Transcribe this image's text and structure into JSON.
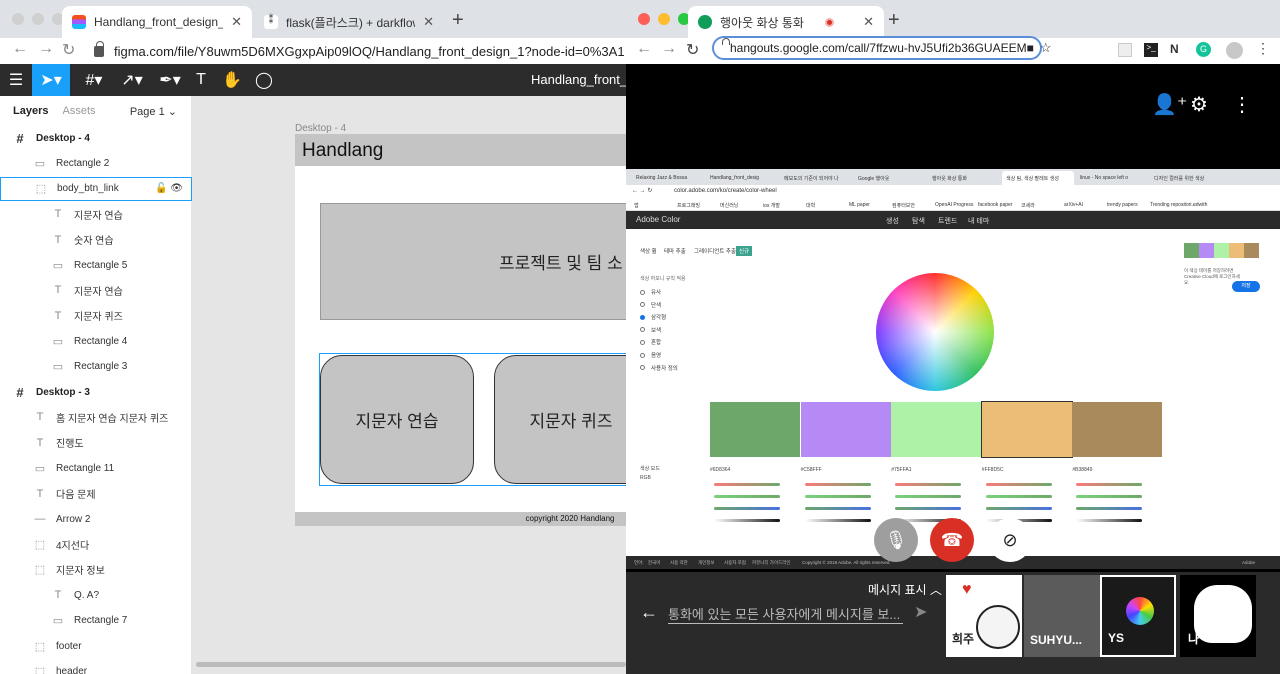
{
  "figma_window": {
    "tabs": [
      {
        "title": "Handlang_front_design_1 – Figma",
        "close": "✕"
      },
      {
        "title": "flask(플라스크) + darkflow YOLO로",
        "close": "✕"
      }
    ],
    "new_tab": "+",
    "url": "figma.com/file/Y8uwm5D6MXGgxpAip09lOQ/Handlang_front_design_1?node-id=0%3A1",
    "toolbar_title": "Handlang_front_de",
    "panel_tabs": {
      "layers": "Layers",
      "assets": "Assets",
      "page": "Page 1"
    },
    "layers": [
      {
        "icon": "frame-icon",
        "label": "Desktop - 4",
        "type": "frame"
      },
      {
        "icon": "rect-icon",
        "label": "Rectangle 2",
        "type": "child"
      },
      {
        "icon": "group-icon",
        "label": "body_btn_link",
        "type": "selected"
      },
      {
        "icon": "text-icon",
        "label": "지문자 연습",
        "type": "grand"
      },
      {
        "icon": "text-icon",
        "label": "숫자 연습",
        "type": "grand"
      },
      {
        "icon": "rect-icon",
        "label": "Rectangle 5",
        "type": "grand"
      },
      {
        "icon": "text-icon",
        "label": "지문자 연습",
        "type": "grand"
      },
      {
        "icon": "text-icon",
        "label": "지문자 퀴즈",
        "type": "grand"
      },
      {
        "icon": "rect-icon",
        "label": "Rectangle 4",
        "type": "grand"
      },
      {
        "icon": "rect-icon",
        "label": "Rectangle 3",
        "type": "grand"
      },
      {
        "icon": "frame-icon",
        "label": "Desktop - 3",
        "type": "frame"
      },
      {
        "icon": "text-icon",
        "label": "홈 지문자 연습 지문자 퀴즈",
        "type": "child"
      },
      {
        "icon": "text-icon",
        "label": "진행도",
        "type": "child"
      },
      {
        "icon": "rect-icon",
        "label": "Rectangle 11",
        "type": "child"
      },
      {
        "icon": "text-icon",
        "label": "다음 문제",
        "type": "child"
      },
      {
        "icon": "line-icon",
        "label": "Arrow 2",
        "type": "child"
      },
      {
        "icon": "group-icon",
        "label": "4지선다",
        "type": "child"
      },
      {
        "icon": "group-icon",
        "label": "지문자 정보",
        "type": "child"
      },
      {
        "icon": "text-icon",
        "label": "Q. A?",
        "type": "grand"
      },
      {
        "icon": "rect-icon",
        "label": "Rectangle 7",
        "type": "grand"
      },
      {
        "icon": "group-icon",
        "label": "footer",
        "type": "child"
      },
      {
        "icon": "group-icon",
        "label": "header",
        "type": "child"
      }
    ],
    "canvas": {
      "frame_label": "Desktop - 4",
      "header_text": "Handlang",
      "banner_text": "프로젝트 및 팀 소",
      "button1": "지문자 연습",
      "button2": "지문자 퀴즈",
      "footer_text": "copyright 2020 Handlang"
    }
  },
  "hangouts_window": {
    "tab_title": "행아웃 화상 통화",
    "close": "✕",
    "new_tab": "+",
    "url": "hangouts.google.com/call/7ffzwu-hvJ5Ufi2b36GUAEEM",
    "shared_screen": {
      "tabs": [
        "Relaxing Jazz & Bossa",
        "Handlang_front_desig",
        "메모도의 기준이 되어야 나",
        "Google 행아웃",
        "행아웃 화상 통화",
        "색상 팀, 색상 팔레트 생성",
        "linux - No space left o",
        "디자인 컬러를 위한 색상"
      ],
      "url": "color.adobe.com/ko/create/color-wheel",
      "bookmarks": [
        "앱",
        "프로그래밍",
        "머신러닝",
        "ios 개발",
        "대학",
        "ML paper",
        "컴퓨터보안",
        "OpenAI Progress",
        "facebook paper",
        "코세라",
        "arXiv+AI",
        "trendy papers",
        "Trending repositori...",
        "edwith"
      ],
      "adobe_title": "Adobe Color",
      "adobe_nav": [
        "생성",
        "탐색",
        "트렌드",
        "내 테마"
      ],
      "mode_tabs": [
        "색상 휠",
        "테마 추출",
        "그레이디언트 추출",
        "신규"
      ],
      "harmony_label": "색상 하모니 규칙 적용",
      "harmony_rules": [
        "유사",
        "단색",
        "삼각형",
        "보색",
        "혼합",
        "음영",
        "사용자 정의"
      ],
      "selected_rule": "삼각형",
      "swatches": [
        {
          "hex": "#6D8364",
          "color": "#6da86a"
        },
        {
          "hex": "#C58FFF",
          "color": "#b68af5"
        },
        {
          "hex": "#75FFA1",
          "color": "#aef2a8"
        },
        {
          "hex": "#FF8D5C",
          "color": "#ecbd76"
        },
        {
          "hex": "#B38849",
          "color": "#a88a5c"
        }
      ],
      "color_mode_label": "색상 모드",
      "color_mode": "RGB",
      "save_note": "이 색상 테마를 저장하려면 Creative Cloud에 로그인하세요.",
      "save_button": "저장",
      "footer_links": [
        "언어:",
        "한국어",
        "사용 약관",
        "개인정보",
        "사용자 포럼",
        "커뮤니티 가이드라인",
        "Copyright © 2019 Adobe. All rights reserved."
      ],
      "adobe_logo": "Adobe"
    },
    "message_toggle": "메시지 표시",
    "message_placeholder": "통화에 있는 모든 사용자에게 메시지를 보...",
    "participants": [
      {
        "name": "희주"
      },
      {
        "name": "SUHYU..."
      },
      {
        "name": "YS"
      },
      {
        "name": "나"
      }
    ]
  },
  "colors": {
    "figma_blue": "#18a0fb",
    "hangup_red": "#d93025",
    "dark_toolbar": "#2c2c2c"
  }
}
